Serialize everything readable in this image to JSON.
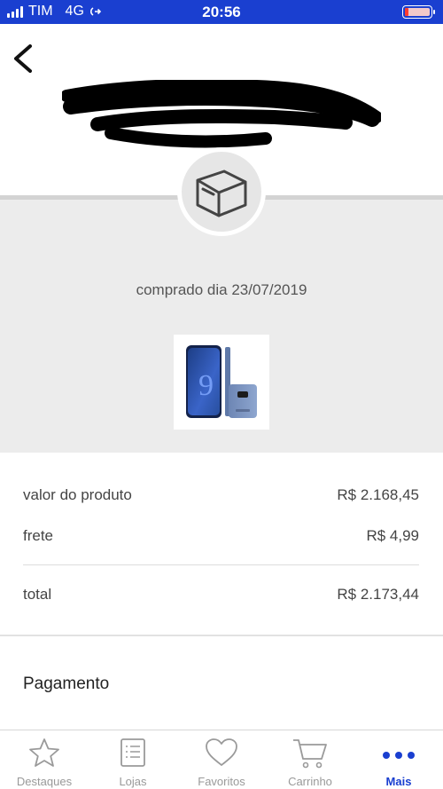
{
  "status_bar": {
    "carrier": "TIM",
    "network": "4G",
    "time": "20:56"
  },
  "order": {
    "purchase_text": "comprado dia 23/07/2019"
  },
  "summary": {
    "product_label": "valor do produto",
    "product_value": "R$ 2.168,45",
    "shipping_label": "frete",
    "shipping_value": "R$ 4,99",
    "total_label": "total",
    "total_value": "R$ 2.173,44"
  },
  "payment": {
    "title": "Pagamento"
  },
  "tabs": [
    {
      "label": "Destaques",
      "icon": "star-icon"
    },
    {
      "label": "Lojas",
      "icon": "list-icon"
    },
    {
      "label": "Favoritos",
      "icon": "heart-icon"
    },
    {
      "label": "Carrinho",
      "icon": "cart-icon"
    },
    {
      "label": "Mais",
      "icon": "more-icon",
      "active": true
    }
  ],
  "colors": {
    "accent": "#1a3fd0",
    "grey_section": "#ececec"
  }
}
